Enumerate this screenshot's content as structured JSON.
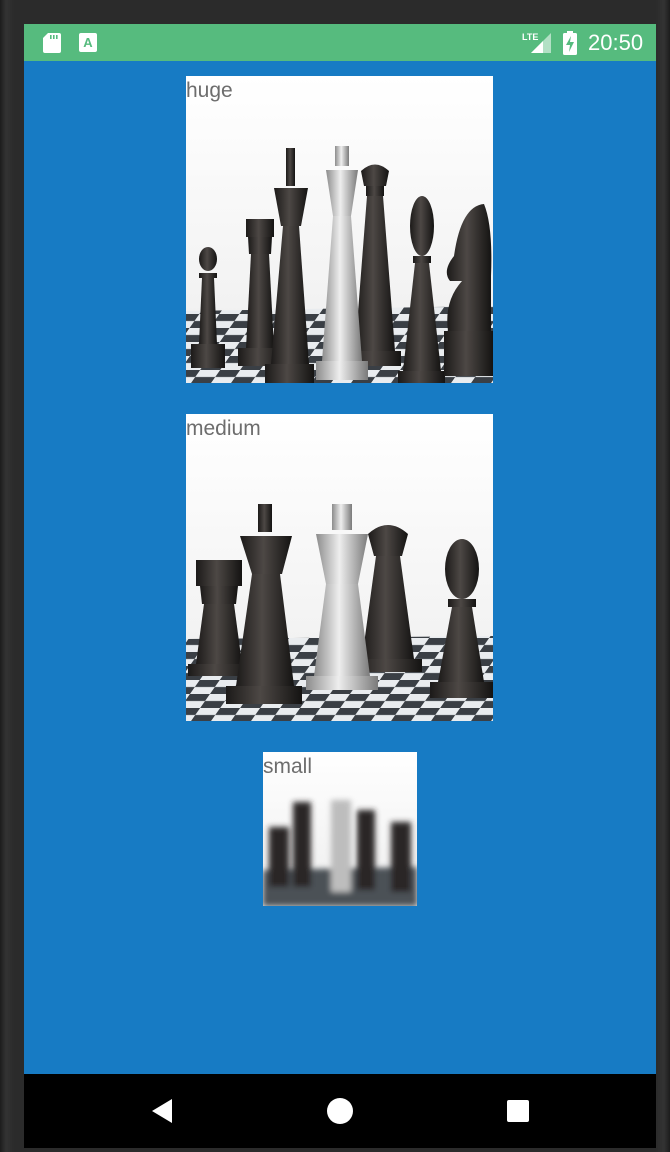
{
  "status_bar": {
    "time": "20:50",
    "network_label": "LTE",
    "left_icons": [
      "sd-card-icon",
      "a-icon"
    ],
    "right_icons": [
      "lte-signal-icon",
      "battery-charging-icon"
    ]
  },
  "images": [
    {
      "label": "huge",
      "subject": "chess-pieces"
    },
    {
      "label": "medium",
      "subject": "chess-pieces"
    },
    {
      "label": "small",
      "subject": "chess-pieces-blurred"
    }
  ],
  "navigation": {
    "buttons": [
      "back-icon",
      "home-icon",
      "recents-icon"
    ]
  },
  "colors": {
    "status_bar": "#56bb7e",
    "background": "#177bc4",
    "label_text": "#6d6d6d",
    "nav_bar": "#000000"
  }
}
